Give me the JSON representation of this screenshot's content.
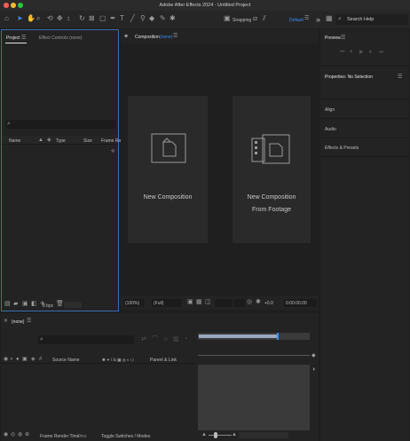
{
  "titlebar": {
    "title": "Adobe After Effects 2024 - Untitled Project"
  },
  "toolbar": {
    "snapping_label": "Snapping",
    "workspace_label": "Default",
    "overflow_label": "»",
    "search_help_label": "Search Help"
  },
  "project_panel": {
    "tab_project": "Project",
    "tab_effect_controls": "Effect Controls (none)",
    "columns": {
      "name": "Name",
      "type": "Type",
      "size": "Size",
      "frame_rate": "Frame Ra..."
    },
    "bpc_label": "8 bpc"
  },
  "composition_panel": {
    "tab_label": "Composition",
    "tab_name": "(none)",
    "new_comp_label": "New Composition",
    "new_comp_footage_line1": "New Composition",
    "new_comp_footage_line2": "From Footage",
    "zoom_value": "(100%)",
    "resolution_value": "(Full)",
    "exposure_value": "+0.0",
    "timecode_value": "0:00:00:00"
  },
  "right_panels": {
    "preview": "Preview",
    "properties": "Properties: No Selection",
    "align": "Align",
    "audio": "Audio",
    "effects_presets": "Effects & Presets"
  },
  "timeline": {
    "tab_label": "(none)",
    "source_name": "Source Name",
    "switches": "✱ ✦ \\ fx ▦ ◎ ◐ ⬡",
    "parent_link": "Parent & Link",
    "frame_render_label": "Frame Render Time",
    "frame_render_value": "0ms",
    "toggle_label": "Toggle Switches / Modes"
  },
  "colors": {
    "accent": "#3c8ff5",
    "panel": "#232323",
    "background": "#1e1e1e"
  }
}
